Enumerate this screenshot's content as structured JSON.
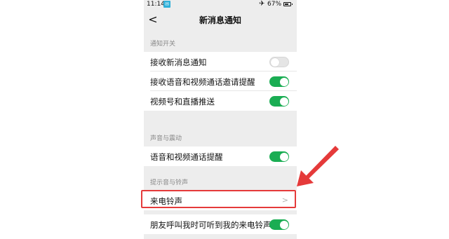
{
  "status_bar": {
    "time": "11:14",
    "battery_text": "67%",
    "battery_level": 0.67,
    "notification_icon": "app-notification-icon",
    "airplane_icon": "airplane-icon"
  },
  "navbar": {
    "back_icon": "chevron-left-icon",
    "title": "新消息通知"
  },
  "sections": {
    "notify_switch": {
      "header": "通知开关",
      "items": [
        {
          "label": "接收新消息通知",
          "toggle": false
        },
        {
          "label": "接收语音和视频通话邀请提醒",
          "toggle": true
        },
        {
          "label": "视频号和直播推送",
          "toggle": true
        }
      ]
    },
    "sound_vibration": {
      "header": "声音与震动",
      "items": [
        {
          "label": "语音和视频通话提醒",
          "toggle": true
        }
      ]
    },
    "tone_ringtone": {
      "header": "提示音与铃声",
      "items": [
        {
          "label": "来电铃声",
          "chevron_icon": "chevron-right-icon"
        },
        {
          "label": "朋友呼叫我时可听到我的来电铃声",
          "toggle": true
        }
      ]
    }
  },
  "annotation": {
    "color": "#e53a3a",
    "target": "来电铃声"
  },
  "colors": {
    "toggle_on": "#1aad53",
    "page_bg": "#ededed"
  }
}
